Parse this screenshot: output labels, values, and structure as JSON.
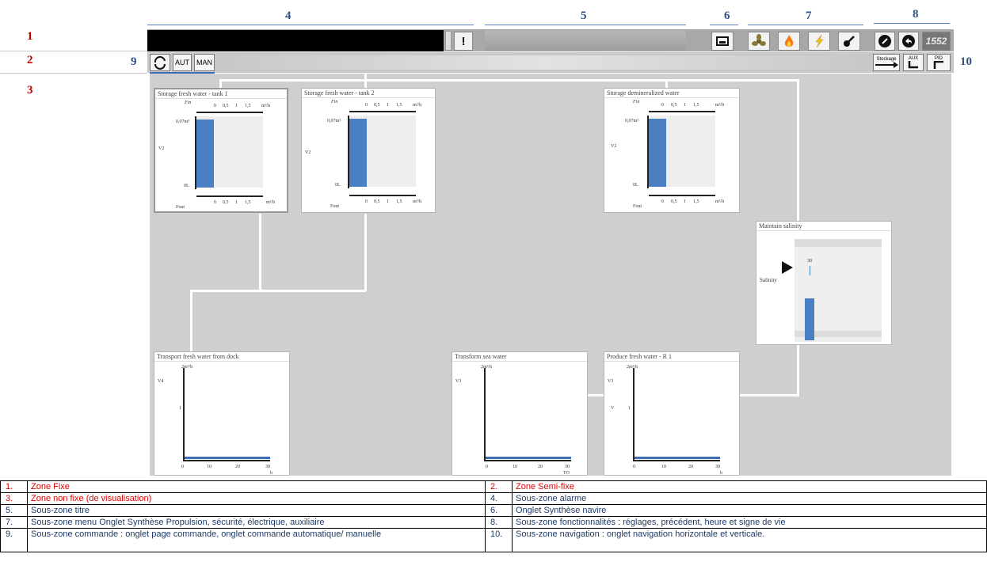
{
  "zones": {
    "z1": "1",
    "z2": "2",
    "z3": "3",
    "z9": "9",
    "z10": "10"
  },
  "sections": {
    "s4": "4",
    "s5": "5",
    "s6": "6",
    "s7": "7",
    "s8": "8"
  },
  "toolbar": {
    "alarm_ack_icon": "!",
    "menu_icons": [
      "ship-synthesis-icon",
      "propulsion-fan-icon",
      "safety-fire-icon",
      "electric-bolt-icon",
      "auxiliary-pipe-icon"
    ],
    "settings_icon": "settings-icon",
    "back_icon": "back-arrow-icon",
    "clock": "1552"
  },
  "command": {
    "aut": "AUT",
    "man": "MAN",
    "refresh_icon": "cycle-icon"
  },
  "navigation": {
    "storage": "Stockage",
    "aux": "AUX",
    "pid": "PID"
  },
  "panels": {
    "tank1": {
      "title": "Storage fresh water - tank 1",
      "fin": "Fin",
      "fout": "Fout",
      "v": "V2",
      "top": "0,07m³",
      "bottom": "0L",
      "ticks": [
        "0",
        "0,5",
        "1",
        "1,5"
      ],
      "unit": "m³/h",
      "level": 0.95
    },
    "tank2": {
      "title": "Storage fresh water - tank 2",
      "fin": "Fin",
      "fout": "Fout",
      "v": "V2",
      "top": "0,07m³",
      "bottom": "0L",
      "ticks": [
        "0",
        "0,5",
        "1",
        "1,5"
      ],
      "unit": "m³/h",
      "level": 0.95
    },
    "demin": {
      "title": "Storage demineralized water",
      "fin": "Fin",
      "fout": "Fout",
      "v": "V2",
      "top": "0,07m³",
      "bottom": "0L",
      "ticks": [
        "0",
        "0,5",
        "1",
        "1,5"
      ],
      "unit": "m³/h",
      "level": 0.95
    },
    "salinity": {
      "title": "Maintain salinity",
      "label": "Salinity",
      "value": "30",
      "level": 0.65
    },
    "transport": {
      "title": "Transport fresh water from dock",
      "v": "V4",
      "ymax": "2m³/h",
      "ymid": "1",
      "xticks": [
        "0",
        "10",
        "20",
        "30"
      ],
      "xunit": "h"
    },
    "transform": {
      "title": "Transform sea water",
      "v": "V3",
      "ymax": "2m³/h",
      "xticks": [
        "0",
        "10",
        "20",
        "30"
      ],
      "xunit": "TO"
    },
    "produce": {
      "title": "Produce fresh water - R 1",
      "v": "V3",
      "v2": "V",
      "ymax": "2m³/h",
      "ymid": "1",
      "xticks": [
        "0",
        "10",
        "20",
        "30"
      ],
      "xunit": "h"
    }
  },
  "legend": [
    [
      "1.",
      "Zone Fixe",
      "2.",
      "Zone Semi-fixe"
    ],
    [
      "3.",
      "Zone non fixe (de visualisation)",
      "4.",
      "Sous-zone alarme"
    ],
    [
      "5.",
      "Sous-zone titre",
      "6.",
      "Onglet Synthèse navire"
    ],
    [
      "7.",
      "Sous-zone menu Onglet Synthèse Propulsion, sécurité, électrique, auxiliaire",
      "8.",
      "Sous-zone fonctionnalités : réglages, précédent, heure et signe de vie"
    ],
    [
      "9.",
      "Sous-zone commande : onglet page commande, onglet commande automatique/ manuelle",
      "10.",
      "Sous-zone navigation : onglet navigation horizontale et verticale."
    ]
  ],
  "colors": {
    "zone_red": "#e00000",
    "section_blue": "#2f4f80",
    "tank_blue": "#4a7fc1"
  }
}
